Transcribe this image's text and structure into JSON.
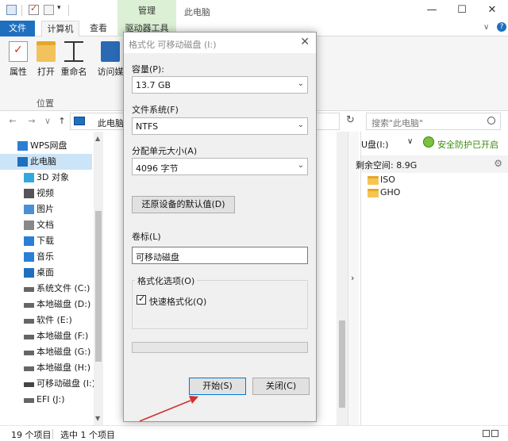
{
  "quick_access": {
    "dropdown": "▾"
  },
  "window": {
    "manage_tab": "管理",
    "title": "此电脑",
    "minimize": "—",
    "maximize": "☐",
    "close": "✕"
  },
  "ribbon_tabs": {
    "file": "文件",
    "computer": "计算机",
    "view": "查看",
    "drive_tools": "驱动器工具",
    "collapse": "∨",
    "help": "?"
  },
  "ribbon": {
    "properties": "属性",
    "open": "打开",
    "rename": "重命名",
    "media": "访问媒",
    "group_label": "位置"
  },
  "address": {
    "back": "←",
    "forward": "→",
    "recent": "∨",
    "up": "↑",
    "path": "此电脑",
    "refresh": "↻",
    "search_placeholder": "搜索\"此电脑\""
  },
  "nav_items": [
    {
      "label": "WPS网盘",
      "icon": "cloud-icon"
    },
    {
      "label": "此电脑",
      "icon": "computer-icon",
      "selected": true
    },
    {
      "label": "3D 对象",
      "icon": "3d-objects-icon"
    },
    {
      "label": "视频",
      "icon": "video-icon"
    },
    {
      "label": "图片",
      "icon": "pictures-icon"
    },
    {
      "label": "文档",
      "icon": "documents-icon"
    },
    {
      "label": "下载",
      "icon": "download-icon"
    },
    {
      "label": "音乐",
      "icon": "music-icon"
    },
    {
      "label": "桌面",
      "icon": "desktop-icon"
    },
    {
      "label": "系统文件 (C:)",
      "icon": "drive-icon"
    },
    {
      "label": "本地磁盘 (D:)",
      "icon": "drive-icon"
    },
    {
      "label": "软件 (E:)",
      "icon": "drive-icon"
    },
    {
      "label": "本地磁盘 (F:)",
      "icon": "drive-icon"
    },
    {
      "label": "本地磁盘 (G:)",
      "icon": "drive-icon"
    },
    {
      "label": "本地磁盘 (H:)",
      "icon": "drive-icon"
    },
    {
      "label": "可移动磁盘 (I:)",
      "icon": "usb-drive-icon"
    },
    {
      "label": "EFI (J:)",
      "icon": "drive-icon"
    }
  ],
  "detail": {
    "drive_name": "U盘(I:)",
    "drive_chev": "∨",
    "protection": "安全防护已开启",
    "free_space": "剩余空间: 8.9G",
    "folders": [
      "ISO",
      "GHO"
    ],
    "expand_arrow": "›"
  },
  "status": {
    "count": "19 个项目",
    "selected": "选中 1 个项目"
  },
  "dialog": {
    "title": "格式化 可移动磁盘 (I:)",
    "close": "✕",
    "capacity_label": "容量(P):",
    "capacity_value": "13.7 GB",
    "fs_label": "文件系统(F)",
    "fs_value": "NTFS",
    "alloc_label": "分配单元大小(A)",
    "alloc_value": "4096 字节",
    "restore_button": "还原设备的默认值(D)",
    "volume_label": "卷标(L)",
    "volume_value": "可移动磁盘",
    "options_title": "格式化选项(O)",
    "quick_format": "快速格式化(Q)",
    "quick_checked": true,
    "progress": 0,
    "start_button": "开始(S)",
    "close_button": "关闭(C)"
  },
  "colors": {
    "accent": "#1f6fbf",
    "manage_tab": "#dcf0d5",
    "annotation_arrow": "#d32f2f",
    "protection_green": "#3b8a0c"
  }
}
